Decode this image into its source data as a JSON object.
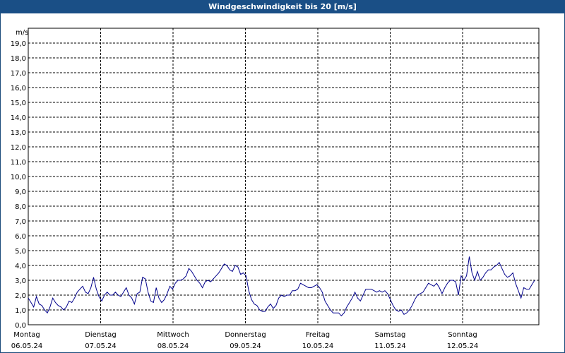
{
  "window": {
    "title": "Windgeschwindigkeit bis 20 [m/s]"
  },
  "chart_data": {
    "type": "line",
    "title": "Windgeschwindigkeit bis 20 [m/s]",
    "ylabel": "m/s",
    "ylim": [
      0,
      20
    ],
    "y_ticks": [
      "0,0",
      "1,0",
      "2,0",
      "3,0",
      "4,0",
      "5,0",
      "6,0",
      "7,0",
      "8,0",
      "9,0",
      "10,0",
      "11,0",
      "12,0",
      "13,0",
      "14,0",
      "15,0",
      "16,0",
      "17,0",
      "18,0",
      "19,0"
    ],
    "x_days": [
      {
        "weekday": "Montag",
        "date": "06.05.24"
      },
      {
        "weekday": "Dienstag",
        "date": "07.05.24"
      },
      {
        "weekday": "Mittwoch",
        "date": "08.05.24"
      },
      {
        "weekday": "Donnerstag",
        "date": "09.05.24"
      },
      {
        "weekday": "Freitag",
        "date": "10.05.24"
      },
      {
        "weekday": "Samstag",
        "date": "11.05.24"
      },
      {
        "weekday": "Sonntag",
        "date": "12.05.24"
      }
    ],
    "grid": true,
    "line_color": "#00008b",
    "series": [
      {
        "values": [
          1.8,
          1.5,
          1.2,
          1.9,
          1.4,
          1.3,
          1.0,
          0.8,
          1.2,
          1.8,
          1.5,
          1.3,
          1.2,
          1.0,
          1.2,
          1.6,
          1.5,
          1.8,
          2.2,
          2.4,
          2.6,
          2.2,
          2.1,
          2.5,
          3.2,
          2.4,
          1.9,
          1.6,
          2.0,
          2.2,
          2.0,
          2.0,
          2.2,
          2.0,
          1.9,
          2.2,
          2.5,
          2.0,
          1.8,
          1.4,
          2.1,
          2.2,
          3.2,
          3.1,
          2.2,
          1.6,
          1.5,
          2.5,
          1.8,
          1.5,
          1.7,
          2.1,
          2.6,
          2.4,
          2.8,
          3.0,
          3.0,
          3.1,
          3.3,
          3.8,
          3.6,
          3.3,
          3.0,
          2.8,
          2.5,
          2.9,
          3.0,
          2.9,
          3.1,
          3.3,
          3.5,
          3.8,
          4.1,
          4.0,
          3.7,
          3.6,
          4.0,
          3.9,
          3.4,
          3.5,
          3.3,
          2.3,
          1.7,
          1.4,
          1.3,
          1.0,
          0.9,
          0.9,
          1.2,
          1.4,
          1.1,
          1.3,
          1.8,
          2.0,
          1.9,
          2.0,
          2.0,
          2.3,
          2.3,
          2.4,
          2.8,
          2.7,
          2.6,
          2.5,
          2.5,
          2.6,
          2.7,
          2.5,
          2.2,
          1.6,
          1.3,
          1.0,
          0.8,
          0.8,
          0.8,
          0.6,
          0.8,
          1.2,
          1.5,
          1.8,
          2.2,
          1.8,
          1.6,
          2.0,
          2.4,
          2.4,
          2.4,
          2.3,
          2.2,
          2.3,
          2.2,
          2.3,
          2.1,
          1.7,
          1.3,
          1.0,
          0.9,
          1.0,
          0.7,
          0.8,
          1.0,
          1.3,
          1.7,
          2.0,
          2.1,
          2.2,
          2.5,
          2.8,
          2.7,
          2.6,
          2.8,
          2.5,
          2.1,
          2.5,
          2.8,
          3.0,
          3.0,
          2.9,
          2.0,
          3.3,
          3.0,
          3.3,
          4.6,
          3.5,
          3.0,
          3.6,
          3.0,
          3.2,
          3.5,
          3.7,
          3.7,
          3.9,
          4.0,
          4.2,
          3.8,
          3.4,
          3.2,
          3.3,
          3.5,
          2.8,
          2.3,
          1.8,
          2.5,
          2.4,
          2.4,
          2.7,
          3.0
        ]
      }
    ]
  }
}
